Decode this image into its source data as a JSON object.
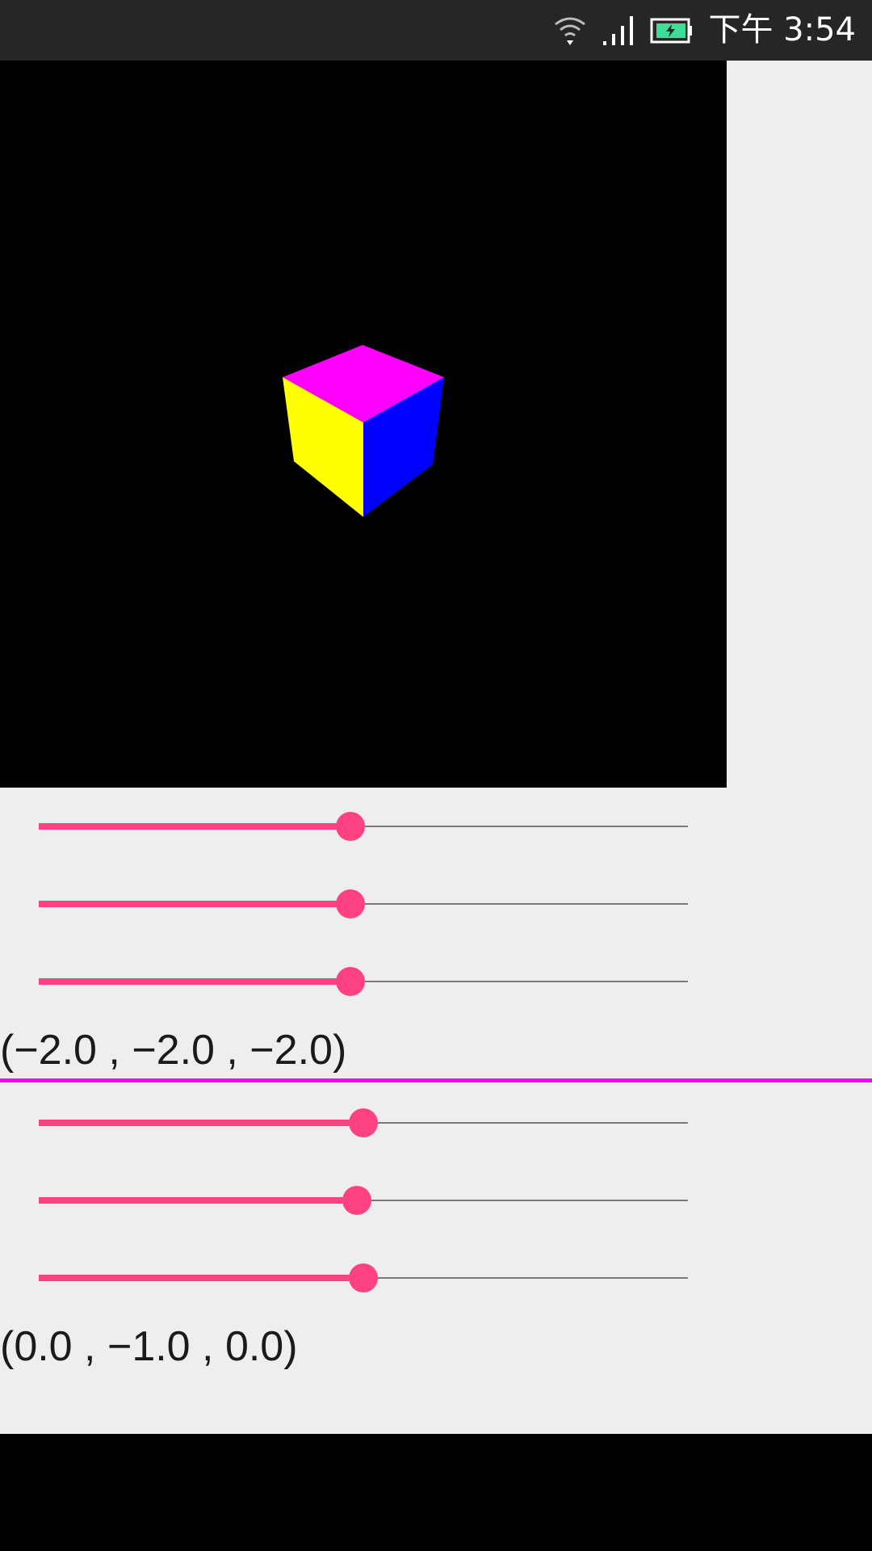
{
  "status_bar": {
    "time": "下午 3:54",
    "icons": [
      "wifi-icon",
      "signal-icon",
      "battery-charging-icon"
    ],
    "battery_color": "#3ddc97"
  },
  "scene": {
    "background": "#000000",
    "cube_faces": {
      "top": "#ff00ff",
      "left": "#ffff00",
      "right": "#0000ff"
    }
  },
  "colors": {
    "accent": "#ff4081",
    "divider": "#ff00ff"
  },
  "group1": {
    "sliders": [
      {
        "name": "x",
        "value": 0.48
      },
      {
        "name": "y",
        "value": 0.48
      },
      {
        "name": "z",
        "value": 0.48
      }
    ],
    "label": "(−2.0 , −2.0 , −2.0)"
  },
  "group2": {
    "sliders": [
      {
        "name": "x",
        "value": 0.5
      },
      {
        "name": "y",
        "value": 0.49
      },
      {
        "name": "z",
        "value": 0.5
      }
    ],
    "label": "(0.0 , −1.0 , 0.0)"
  }
}
